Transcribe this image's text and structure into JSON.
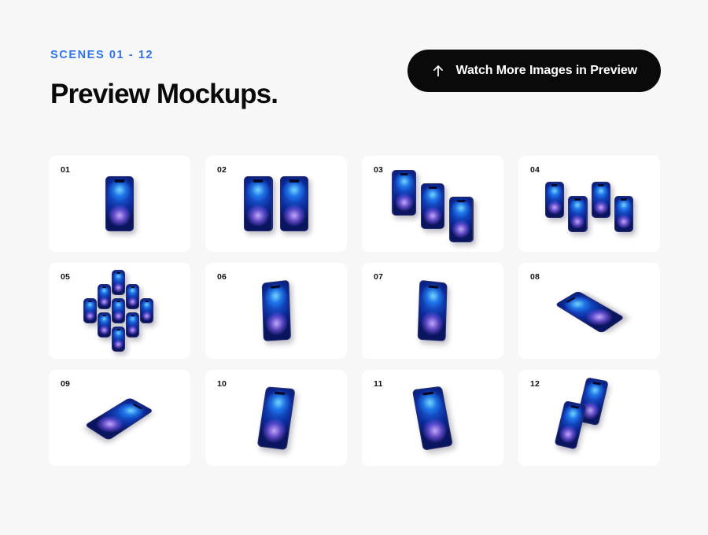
{
  "header": {
    "eyebrow": "SCENES 01 - 12",
    "title": "Preview Mockups.",
    "cta_label": "Watch More Images in Preview",
    "cta_icon": "arrow-up-icon"
  },
  "colors": {
    "background": "#f7f7f7",
    "card": "#ffffff",
    "accent_blue": "#2e73e8",
    "text_dark": "#0a0a0a",
    "button_bg": "#0a0a0a",
    "button_text": "#ffffff",
    "device_bezel": "#2a2f6b",
    "wallpaper_cyan": "#78dcff",
    "wallpaper_blue": "#1d6ae8",
    "wallpaper_violet": "#cdafff",
    "wallpaper_navy": "#0a1560"
  },
  "grid": {
    "columns": 4,
    "rows": 3,
    "cards": [
      {
        "number": "01",
        "scene": "single-phone-front",
        "device_count": 1
      },
      {
        "number": "02",
        "scene": "two-phones-side-by-side",
        "device_count": 2
      },
      {
        "number": "03",
        "scene": "three-phones-descending",
        "device_count": 3
      },
      {
        "number": "04",
        "scene": "four-phones-zigzag",
        "device_count": 4
      },
      {
        "number": "05",
        "scene": "nine-phones-diamond-grid",
        "device_count": 9
      },
      {
        "number": "06",
        "scene": "phone-perspective-left",
        "device_count": 1
      },
      {
        "number": "07",
        "scene": "phone-perspective-right",
        "device_count": 1
      },
      {
        "number": "08",
        "scene": "phone-isometric-landscape-left",
        "device_count": 1
      },
      {
        "number": "09",
        "scene": "phone-isometric-landscape-right",
        "device_count": 1
      },
      {
        "number": "10",
        "scene": "phone-tilted-left",
        "device_count": 1
      },
      {
        "number": "11",
        "scene": "phone-tilted-right",
        "device_count": 1
      },
      {
        "number": "12",
        "scene": "two-phones-overlapping-angled",
        "device_count": 2
      }
    ]
  }
}
